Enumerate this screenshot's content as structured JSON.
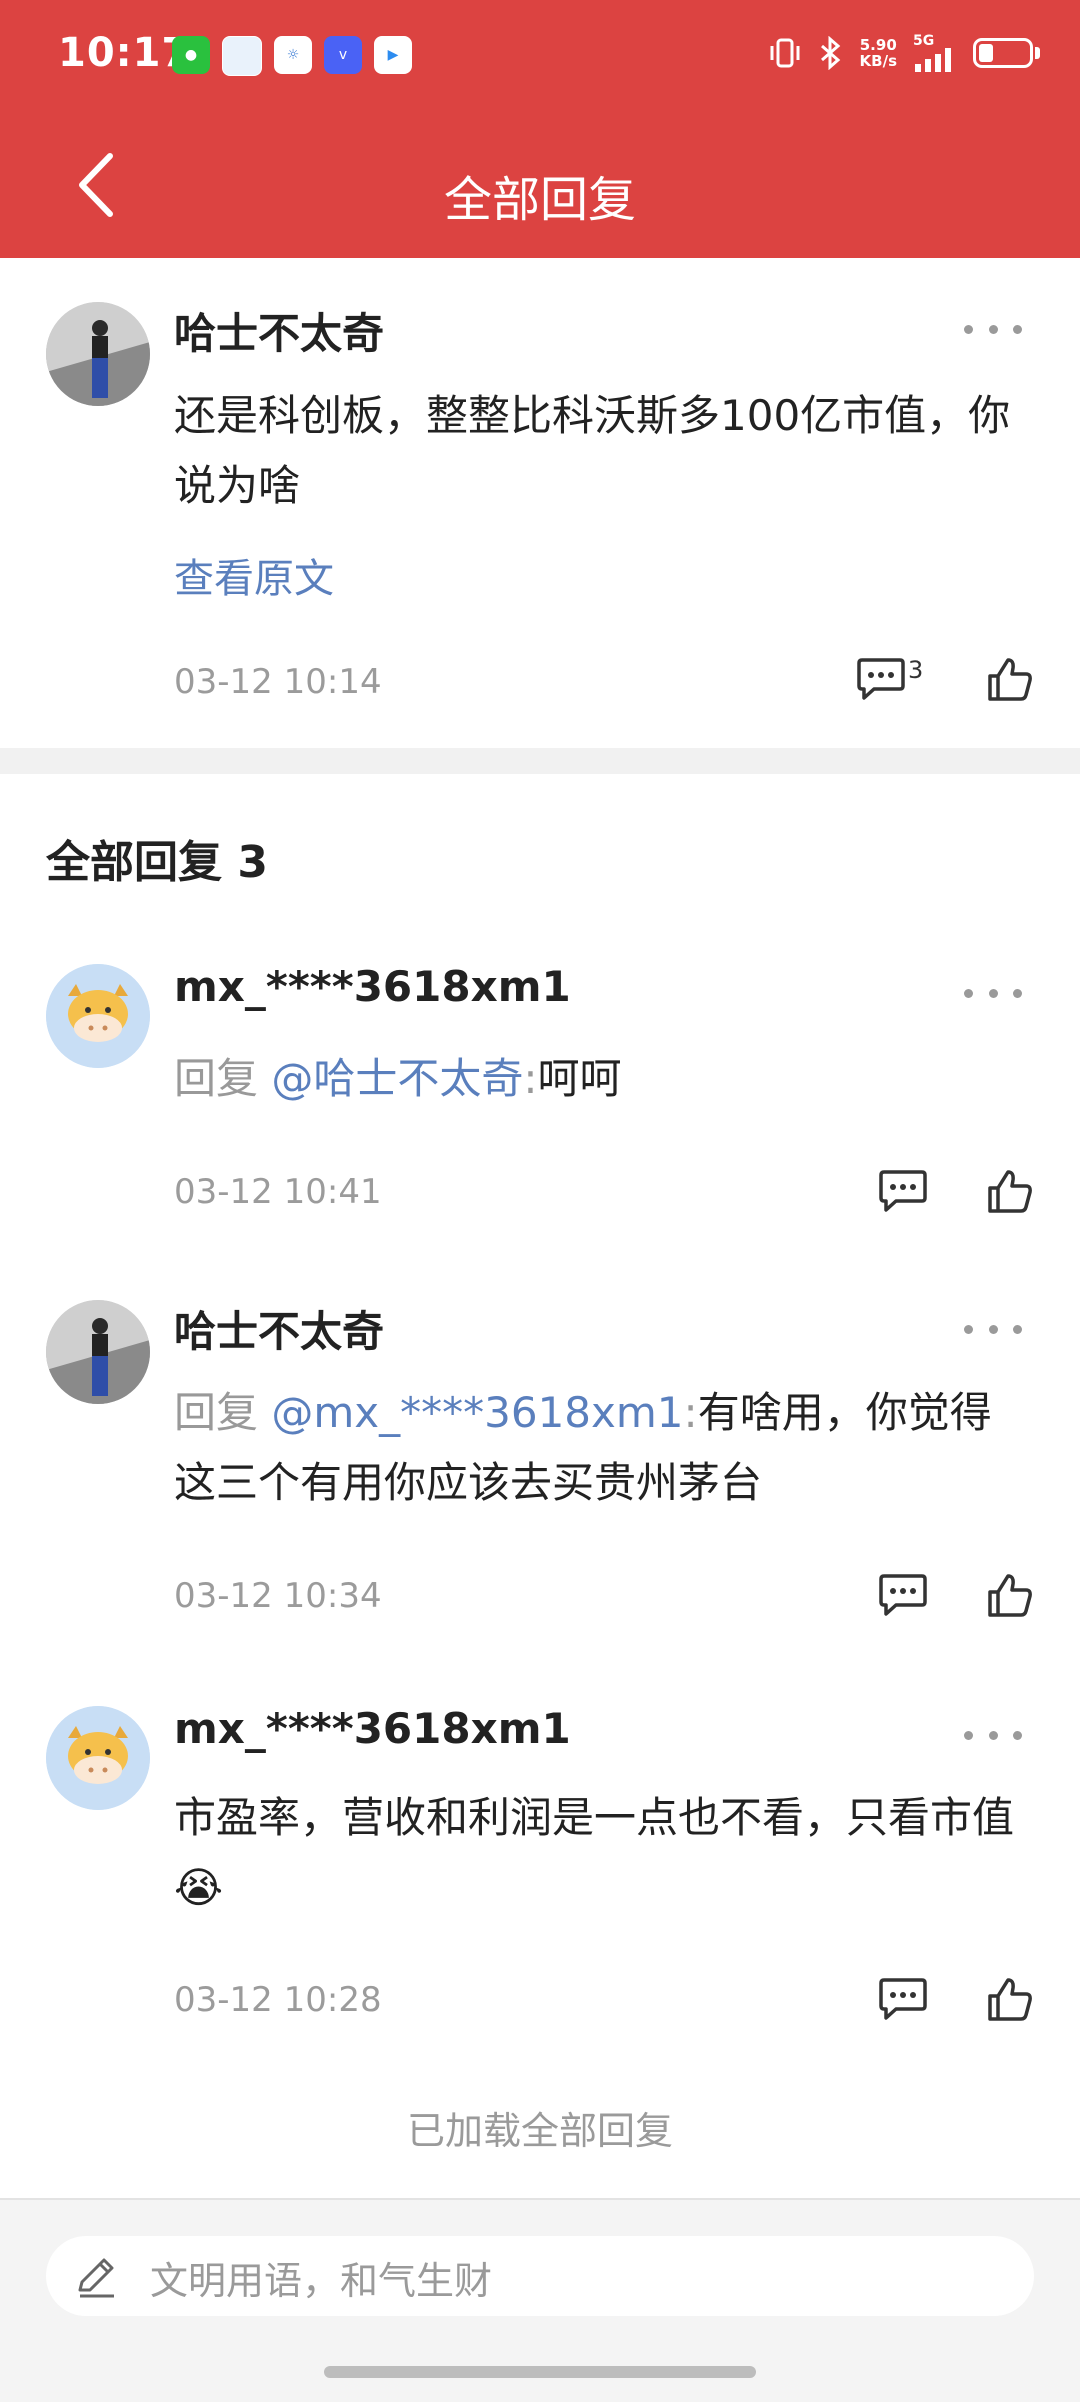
{
  "status_bar": {
    "time": "10:17",
    "speed_value": "5.90",
    "speed_unit": "KB/s",
    "network": "5G"
  },
  "header": {
    "title": "全部回复"
  },
  "original_post": {
    "username": "哈士不太奇",
    "content": "还是科创板，整整比科沃斯多100亿市值，你说为啥",
    "view_original": "查看原文",
    "time": "03-12 10:14",
    "comment_count": "3"
  },
  "replies_section": {
    "title": "全部回复 3",
    "loaded_text": "已加载全部回复"
  },
  "replies": [
    {
      "username": "mx_****3618xm1",
      "reply_prefix": "回复",
      "mention": "@哈士不太奇",
      "colon": ":",
      "text": "呵呵",
      "time": "03-12 10:41"
    },
    {
      "username": "哈士不太奇",
      "reply_prefix": "回复",
      "mention": "@mx_****3618xm1",
      "colon": ":",
      "text": "有啥用，你觉得这三个有用你应该去买贵州茅台",
      "time": "03-12 10:34"
    },
    {
      "username": "mx_****3618xm1",
      "text": "市盈率，营收和利润是一点也不看，只看市值",
      "emoji": "😭",
      "time": "03-12 10:28"
    }
  ],
  "input": {
    "placeholder": "文明用语，和气生财"
  },
  "icons": {
    "back": "chevron-left-icon",
    "more": "more-dots-icon",
    "comment": "comment-icon",
    "like": "thumbs-up-icon",
    "edit": "pencil-icon"
  },
  "colors": {
    "brand": "#dc4341",
    "link": "#5a7fbd",
    "muted": "#9b9b9b"
  }
}
